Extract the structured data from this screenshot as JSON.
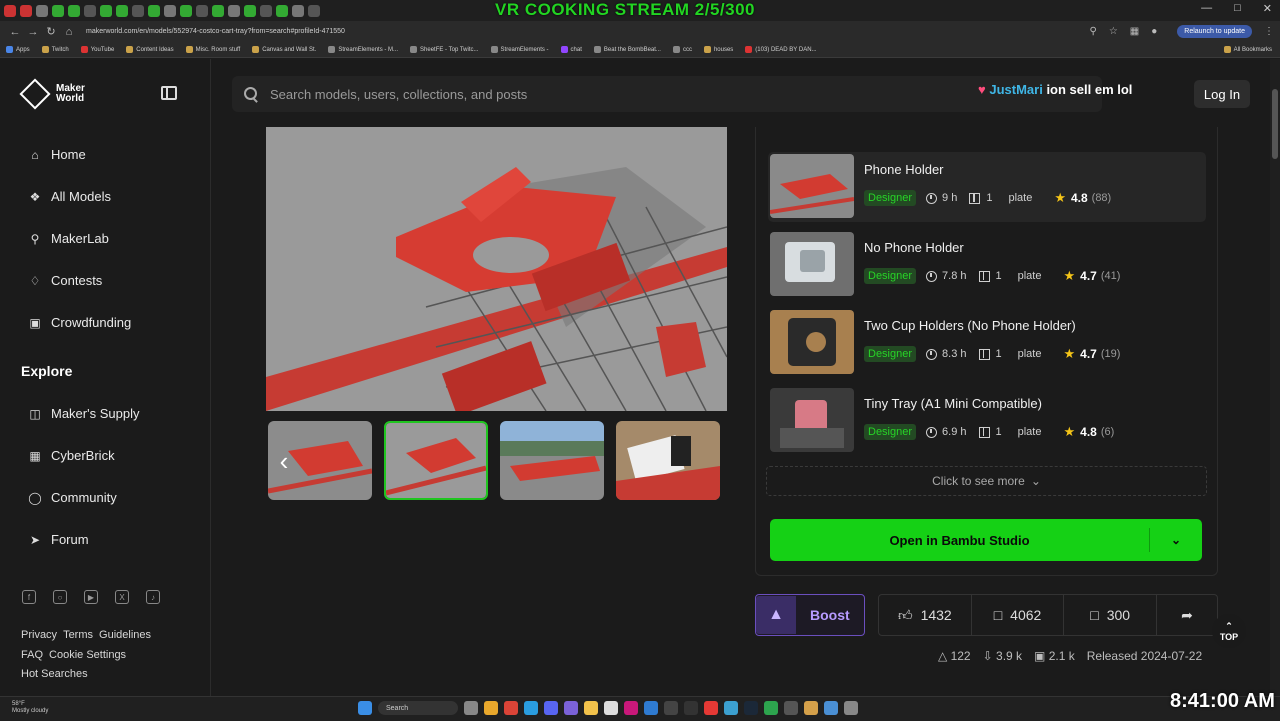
{
  "browser": {
    "stream_banner": "VR COOKING STREAM 2/5/300",
    "url": "makerworld.com/en/models/552974-costco-cart-tray?from=search#profileId-471550",
    "relaunch_label": "Relaunch to update",
    "bookmarks": [
      "Apps",
      "Twitch",
      "YouTube",
      "Content Ideas",
      "Misc. Room stuff",
      "Canvas and Wall St.",
      "StreamElements - M...",
      "SheetFE - Top Twitc...",
      "StreamElements -",
      "chat",
      "Beat the BombBeat...",
      "ccc",
      "houses",
      "(103) DEAD BY DAN..."
    ],
    "all_bookmarks": "All Bookmarks"
  },
  "sidebar": {
    "logo_text": "Maker World",
    "nav": [
      {
        "label": "Home",
        "icon": "home-icon"
      },
      {
        "label": "All Models",
        "icon": "cubes-icon"
      },
      {
        "label": "MakerLab",
        "icon": "flask-icon"
      },
      {
        "label": "Contests",
        "icon": "trophy-icon"
      },
      {
        "label": "Crowdfunding",
        "icon": "crowdfunding-icon"
      }
    ],
    "explore_heading": "Explore",
    "explore": [
      {
        "label": "Maker's Supply",
        "icon": "bag-icon"
      },
      {
        "label": "CyberBrick",
        "icon": "brick-icon"
      },
      {
        "label": "Community",
        "icon": "globe-icon"
      },
      {
        "label": "Forum",
        "icon": "send-icon"
      }
    ],
    "social": [
      "facebook-icon",
      "instagram-icon",
      "youtube-icon",
      "x-icon",
      "tiktok-icon"
    ],
    "footer_row1": [
      "Privacy",
      "Terms",
      "Guidelines"
    ],
    "footer_row2": [
      "FAQ",
      "Cookie Settings"
    ],
    "footer_row3": [
      "Hot Searches"
    ]
  },
  "header": {
    "search_placeholder": "Search models, users, collections, and posts",
    "chat_user": "JustMari",
    "chat_message": "ion sell em lol",
    "login_label": "Log In"
  },
  "profiles": [
    {
      "title": "Phone Holder",
      "badge": "Designer",
      "time": "9 h",
      "plates": "1",
      "plate_label": "plate",
      "rating": "4.8",
      "count": "(88)"
    },
    {
      "title": "No Phone Holder",
      "badge": "Designer",
      "time": "7.8 h",
      "plates": "1",
      "plate_label": "plate",
      "rating": "4.7",
      "count": "(41)"
    },
    {
      "title": "Two Cup Holders (No Phone Holder)",
      "badge": "Designer",
      "time": "8.3 h",
      "plates": "1",
      "plate_label": "plate",
      "rating": "4.7",
      "count": "(19)"
    },
    {
      "title": "Tiny Tray (A1 Mini Compatible)",
      "badge": "Designer",
      "time": "6.9 h",
      "plates": "1",
      "plate_label": "plate",
      "rating": "4.8",
      "count": "(6)"
    }
  ],
  "see_more": "Click to see more",
  "open_button": "Open in Bambu Studio",
  "boost_label": "Boost",
  "stats": {
    "likes": "1432",
    "collects": "4062",
    "comments": "300"
  },
  "info": {
    "prints": "122",
    "downloads": "3.9 k",
    "boosts": "2.1 k",
    "released": "Released 2024-07-22"
  },
  "top_label": "TOP",
  "taskbar": {
    "weather_temp": "58°F",
    "weather_desc": "Mostly cloudy",
    "search": "Search"
  },
  "clock": "8:41:00 AM"
}
